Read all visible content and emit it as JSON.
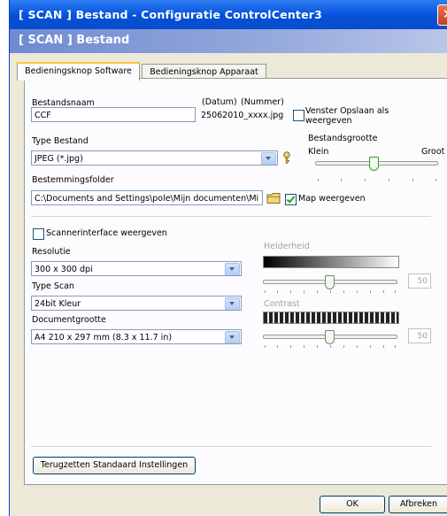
{
  "window": {
    "title": "[ SCAN ]  Bestand - Configuratie ControlCenter3",
    "close_glyph": "✕"
  },
  "banner": {
    "title": "[ SCAN ]  Bestand"
  },
  "tabs": [
    {
      "label": "Bedieningsknop Software",
      "active": true
    },
    {
      "label": "Bedieningsknop Apparaat",
      "active": false
    }
  ],
  "file": {
    "name_label": "Bestandsnaam",
    "name_value": "CCF",
    "datum_label": "(Datum)",
    "nummer_label": "(Nummer)",
    "suffix": "25062010_xxxx.jpg",
    "save_as_label_1": "Venster Opslaan als",
    "save_as_label_2": "weergeven",
    "save_as_checked": false
  },
  "filetype": {
    "label": "Type Bestand",
    "value": "JPEG (*.jpg)",
    "options_icon": "key-icon"
  },
  "filesize": {
    "label": "Bestandsgrootte",
    "min_label": "Klein",
    "max_label": "Groot",
    "level": 0.45
  },
  "destination": {
    "label": "Bestemmingsfolder",
    "value": "C:\\Documents and Settings\\pole\\Mijn documenten\\Mi",
    "browse_icon": "folder-icon",
    "show_map_label": "Map weergeven",
    "show_map_checked": true
  },
  "scanner_ui": {
    "label": "Scannerinterface weergeven",
    "checked": false
  },
  "resolution": {
    "label": "Resolutie",
    "value": "300 x 300 dpi"
  },
  "scan_type": {
    "label": "Type Scan",
    "value": "24bit Kleur"
  },
  "doc_size": {
    "label": "Documentgrootte",
    "value": "A4 210 x 297 mm (8.3 x 11.7 in)"
  },
  "brightness": {
    "label": "Helderheid",
    "value": "50",
    "level": 0.5
  },
  "contrast": {
    "label": "Contrast",
    "value": "50",
    "level": 0.5
  },
  "buttons": {
    "restore_defaults": "Terugzetten Standaard Instellingen",
    "ok": "OK",
    "cancel": "Afbreken"
  }
}
